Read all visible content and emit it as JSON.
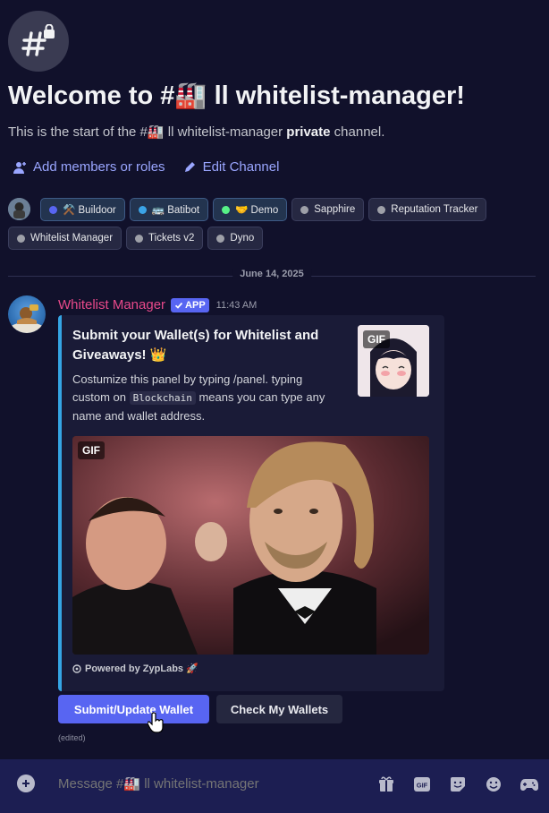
{
  "channel": {
    "welcome_title": "Welcome to #🏭 ll whitelist-manager!",
    "intro_prefix": "This is the start of the #🏭 ll whitelist-manager ",
    "intro_bold": "private",
    "intro_suffix": " channel.",
    "add_members_label": "Add members or roles",
    "edit_channel_label": "Edit Channel"
  },
  "bots": [
    {
      "label": "⚒️ Buildoor",
      "color": "#5865f2"
    },
    {
      "label": "🚌 Batibot",
      "color": "#3ba4e6"
    },
    {
      "label": "🤝 Demo",
      "color": "#57f287"
    },
    {
      "label": "Sapphire",
      "color": "#9ea0a8"
    },
    {
      "label": "Reputation Tracker",
      "color": "#9ea0a8"
    },
    {
      "label": "Whitelist Manager",
      "color": "#9ea0a8"
    },
    {
      "label": "Tickets v2",
      "color": "#9ea0a8"
    },
    {
      "label": "Dyno",
      "color": "#9ea0a8"
    }
  ],
  "date_divider": "June 14, 2025",
  "message": {
    "author": "Whitelist Manager",
    "badge": "APP",
    "time": "11:43 AM",
    "embed": {
      "title": "Submit your Wallet(s) for Whitelist and Giveaways! 👑",
      "desc_part1": "Costumize this panel by typing /panel. typing custom on ",
      "desc_code": "Blockchain",
      "desc_part2": " means you can type any name and wallet address.",
      "thumb_tag": "GIF",
      "image_tag": "GIF",
      "footer": "Powered by ZypLabs 🚀",
      "accent_color": "#35a5e4"
    },
    "buttons": {
      "primary": "Submit/Update Wallet",
      "secondary": "Check My Wallets"
    },
    "edited": "(edited)"
  },
  "composer": {
    "placeholder": "Message #🏭 ll whitelist-manager"
  }
}
